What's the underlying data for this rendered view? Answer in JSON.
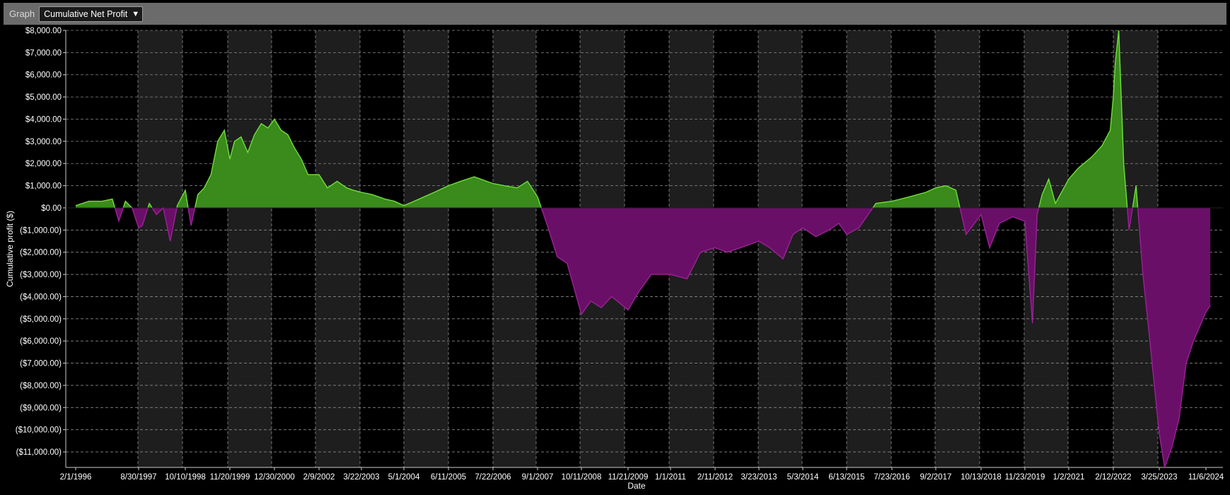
{
  "toolbar": {
    "label": "Graph",
    "select_value": "Cumulative Net Profit"
  },
  "colors": {
    "positive_fill": "#3a8a1c",
    "positive_line": "#6fe03a",
    "negative_fill": "#6a0f68",
    "negative_line": "#9a2296",
    "band": "#1e1e1e",
    "grid": "#8a8a8a"
  },
  "chart_data": {
    "type": "area",
    "xlabel": "Date",
    "ylabel": "Cumulative profit ($)",
    "ylim": [
      -11700,
      8000
    ],
    "y_ticks": [
      8000,
      7000,
      6000,
      5000,
      4000,
      3000,
      2000,
      1000,
      0,
      -1000,
      -2000,
      -3000,
      -4000,
      -5000,
      -6000,
      -7000,
      -8000,
      -9000,
      -10000,
      -11000
    ],
    "y_tick_labels": [
      "$8,000.00",
      "$7,000.00",
      "$6,000.00",
      "$5,000.00",
      "$4,000.00",
      "$3,000.00",
      "$2,000.00",
      "$1,000.00",
      "$0.00",
      "($1,000.00)",
      "($2,000.00)",
      "($3,000.00)",
      "($4,000.00)",
      "($5,000.00)",
      "($6,000.00)",
      "($7,000.00)",
      "($8,000.00)",
      "($9,000.00)",
      "($10,000.00)",
      "($11,000.00)"
    ],
    "x_ticks": [
      "2/1/1996",
      "8/30/1997",
      "10/10/1998",
      "11/20/1999",
      "12/30/2000",
      "2/9/2002",
      "3/22/2003",
      "5/1/2004",
      "6/11/2005",
      "7/22/2006",
      "9/1/2007",
      "10/11/2008",
      "11/21/2009",
      "1/1/2011",
      "2/11/2012",
      "3/23/2013",
      "5/3/2014",
      "6/13/2015",
      "7/23/2016",
      "9/2/2017",
      "10/13/2018",
      "11/23/2019",
      "1/2/2021",
      "2/12/2022",
      "3/25/2023",
      "11/6/2024"
    ],
    "grid": true,
    "series": [
      {
        "x": [
          "1996-02-01",
          "1996-06-01",
          "1996-10-01",
          "1997-01-01",
          "1997-03-01",
          "1997-05-01",
          "1997-07-01",
          "1997-08-30",
          "1997-10-01",
          "1997-12-01",
          "1998-02-01",
          "1998-04-01",
          "1998-06-01",
          "1998-08-01",
          "1998-10-10",
          "1998-12-01",
          "1999-02-01",
          "1999-04-01",
          "1999-06-01",
          "1999-08-01",
          "1999-10-01",
          "1999-11-20",
          "2000-01-01",
          "2000-03-01",
          "2000-05-01",
          "2000-07-01",
          "2000-09-01",
          "2000-11-01",
          "2000-12-30",
          "2001-03-01",
          "2001-05-01",
          "2001-07-01",
          "2001-09-01",
          "2001-11-01",
          "2002-02-09",
          "2002-05-01",
          "2002-08-01",
          "2002-11-01",
          "2003-01-01",
          "2003-03-22",
          "2003-07-01",
          "2003-11-01",
          "2004-02-01",
          "2004-05-01",
          "2004-08-01",
          "2004-11-01",
          "2005-02-01",
          "2005-06-11",
          "2005-10-01",
          "2006-02-01",
          "2006-07-22",
          "2006-11-01",
          "2007-03-01",
          "2007-06-01",
          "2007-09-01",
          "2007-12-01",
          "2008-03-01",
          "2008-06-01",
          "2008-10-11",
          "2009-01-01",
          "2009-04-01",
          "2009-07-01",
          "2009-11-21",
          "2010-03-01",
          "2010-07-01",
          "2011-01-01",
          "2011-06-01",
          "2011-10-01",
          "2012-02-11",
          "2012-06-01",
          "2012-10-01",
          "2013-03-23",
          "2013-07-01",
          "2013-11-01",
          "2014-02-01",
          "2014-05-03",
          "2014-09-01",
          "2015-01-01",
          "2015-04-01",
          "2015-06-13",
          "2015-10-01",
          "2016-03-01",
          "2016-07-23",
          "2017-01-01",
          "2017-06-01",
          "2017-09-02",
          "2017-12-01",
          "2018-03-01",
          "2018-06-01",
          "2018-10-13",
          "2019-01-01",
          "2019-04-01",
          "2019-08-01",
          "2019-11-23",
          "2020-02-01",
          "2020-03-15",
          "2020-05-01",
          "2020-07-01",
          "2020-09-01",
          "2021-01-02",
          "2021-04-01",
          "2021-08-01",
          "2021-11-01",
          "2022-01-15",
          "2022-02-12",
          "2022-03-01",
          "2022-04-01",
          "2022-05-15",
          "2022-07-01",
          "2022-09-01",
          "2022-11-01",
          "2023-01-01",
          "2023-03-25",
          "2023-06-01",
          "2023-09-01",
          "2023-12-01",
          "2024-03-01",
          "2024-06-01",
          "2024-11-06",
          "2024-12-31"
        ],
        "y": [
          100,
          300,
          300,
          400,
          -600,
          300,
          0,
          -900,
          -800,
          200,
          -300,
          0,
          -1500,
          100,
          800,
          -800,
          600,
          900,
          1500,
          3000,
          3500,
          2200,
          3000,
          3200,
          2500,
          3300,
          3800,
          3600,
          4000,
          3500,
          3300,
          2700,
          2200,
          1500,
          1500,
          900,
          1200,
          900,
          800,
          700,
          600,
          400,
          300,
          100,
          300,
          500,
          700,
          1000,
          1200,
          1400,
          1100,
          1000,
          900,
          1200,
          500,
          -800,
          -2200,
          -2500,
          -4800,
          -4200,
          -4500,
          -4000,
          -4600,
          -3800,
          -3000,
          -3000,
          -3200,
          -2000,
          -1800,
          -2000,
          -1800,
          -1500,
          -1800,
          -2300,
          -1200,
          -900,
          -1300,
          -1000,
          -700,
          -1200,
          -900,
          200,
          300,
          500,
          700,
          900,
          1000,
          800,
          -1200,
          -300,
          -1800,
          -700,
          -400,
          -600,
          -5200,
          -300,
          600,
          1300,
          200,
          1300,
          1800,
          2300,
          2800,
          3500,
          5000,
          6500,
          8000,
          2000,
          -1000,
          1000,
          -3000,
          -6000,
          -10200,
          -11700,
          -10800,
          -9500,
          -7000,
          -6000,
          -4700,
          -4400
        ]
      }
    ]
  }
}
